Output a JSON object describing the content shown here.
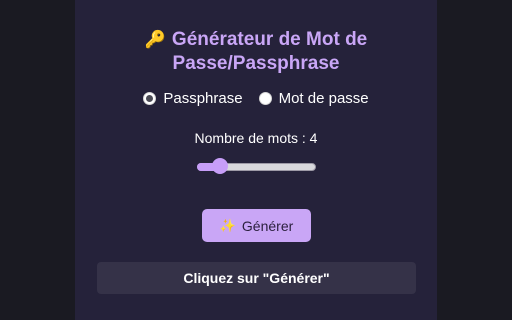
{
  "colors": {
    "background": "#1a1a22",
    "panel": "#25223a",
    "accent": "#c9a6f6",
    "result_box": "#353248"
  },
  "header": {
    "icon": "key-icon",
    "title_line1": "Générateur de Mot de",
    "title_line2": "Passe/Passphrase"
  },
  "mode": {
    "options": [
      {
        "label": "Passphrase",
        "selected": true
      },
      {
        "label": "Mot de passe",
        "selected": false
      }
    ]
  },
  "word_count": {
    "label": "Nombre de mots : 4",
    "value": 4,
    "min": 3,
    "max": 10
  },
  "generate": {
    "icon": "sparkles-icon",
    "label": "Générer"
  },
  "result": {
    "text": "Cliquez sur \"Générer\""
  }
}
